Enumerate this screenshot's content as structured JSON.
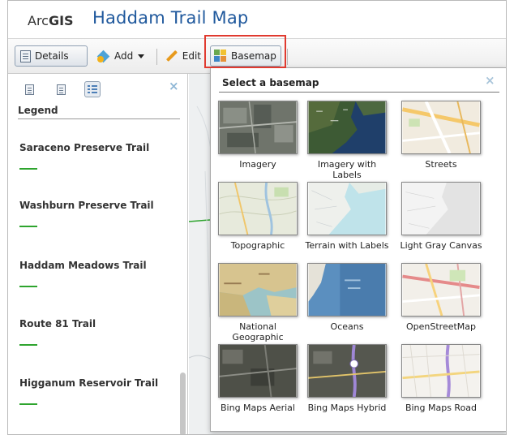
{
  "header": {
    "brand_prefix": "Arc",
    "brand_suffix": "GIS",
    "title": "Haddam Trail Map"
  },
  "toolbar": {
    "details_label": "Details",
    "add_label": "Add",
    "edit_label": "Edit",
    "basemap_label": "Basemap"
  },
  "left_panel": {
    "legend_header": "Legend",
    "close_icon": "×",
    "legend_items": [
      {
        "label": "Saraceno Preserve Trail"
      },
      {
        "label": "Washburn Preserve Trail"
      },
      {
        "label": "Haddam Meadows Trail"
      },
      {
        "label": "Route 81 Trail"
      },
      {
        "label": "Higganum Reservoir Trail"
      }
    ],
    "legend_line_color": "#2ea42e"
  },
  "gallery": {
    "title": "Select a basemap",
    "close_icon": "×",
    "items": [
      {
        "label": "Imagery",
        "thumb": "imagery"
      },
      {
        "label": "Imagery with Labels",
        "thumb": "imagery-labels"
      },
      {
        "label": "Streets",
        "thumb": "streets"
      },
      {
        "label": "Topographic",
        "thumb": "topographic"
      },
      {
        "label": "Terrain with Labels",
        "thumb": "terrain"
      },
      {
        "label": "Light Gray Canvas",
        "thumb": "light-gray"
      },
      {
        "label": "National Geographic",
        "thumb": "natgeo"
      },
      {
        "label": "Oceans",
        "thumb": "oceans"
      },
      {
        "label": "OpenStreetMap",
        "thumb": "osm"
      },
      {
        "label": "Bing Maps Aerial",
        "thumb": "bing-aerial"
      },
      {
        "label": "Bing Maps Hybrid",
        "thumb": "bing-hybrid"
      },
      {
        "label": "Bing Maps Road",
        "thumb": "bing-road"
      }
    ]
  },
  "colors": {
    "title_blue": "#20599d",
    "highlight_red": "#e03a2f"
  }
}
